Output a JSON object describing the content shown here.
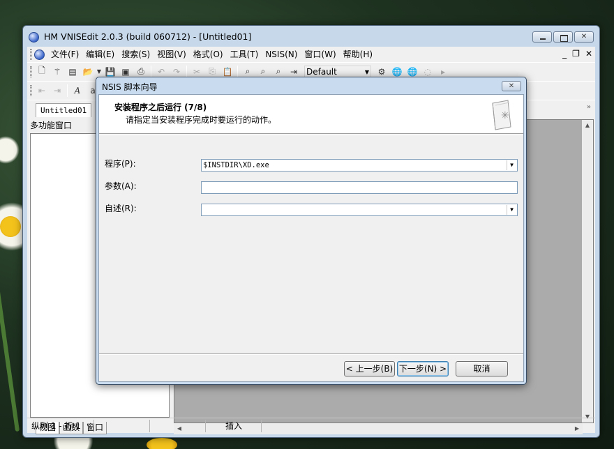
{
  "window": {
    "title": "HM VNISEdit 2.0.3 (build 060712) - [Untitled01]"
  },
  "menu": [
    "文件(F)",
    "编辑(E)",
    "搜索(S)",
    "视图(V)",
    "格式(O)",
    "工具(T)",
    "NSIS(N)",
    "窗口(W)",
    "帮助(H)"
  ],
  "toolbar": {
    "style_combo": "Default"
  },
  "document_tab": "Untitled01",
  "left_panel": {
    "title": "多功能窗口",
    "tabs": [
      "视图",
      "函数",
      "窗口"
    ]
  },
  "statusbar": {
    "position": "纵列 1 - 行 1",
    "mode": "插入"
  },
  "dialog": {
    "title": "NSIS 脚本向导",
    "step_title": "安装程序之后运行 (7/8)",
    "step_desc": "请指定当安装程序完成时要运行的动作。",
    "program_label": "程序(P):",
    "program_value": "$INSTDIR\\XD.exe",
    "params_label": "参数(A):",
    "params_value": "",
    "readme_label": "自述(R):",
    "readme_value": "",
    "back_button": "< 上一步(B)",
    "next_button": "下一步(N) >",
    "cancel_button": "取消"
  },
  "colors": {
    "window_frame": "#c7d8ea",
    "dialog_frame": "#c9dcef",
    "editor_bg": "#ababab"
  }
}
